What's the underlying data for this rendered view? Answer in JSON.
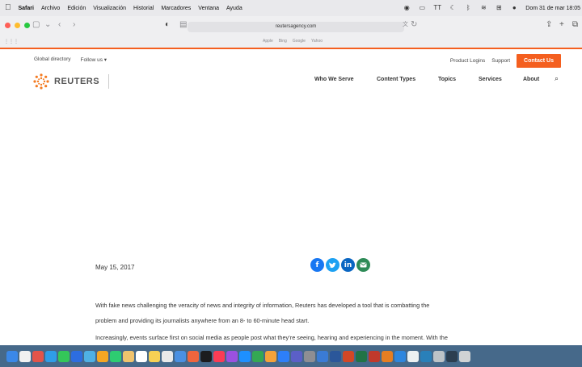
{
  "menubar": {
    "app": "Safari",
    "items": [
      "Archivo",
      "Edición",
      "Visualización",
      "Historial",
      "Marcadores",
      "Ventana",
      "Ayuda"
    ],
    "clock": "Dom 31 de mar  18:05"
  },
  "browser": {
    "url": "reutersagency.com",
    "favorites": [
      "Apple",
      "Bing",
      "Google",
      "Yahoo"
    ]
  },
  "site": {
    "logo_text": "REUTERS",
    "top_links": {
      "global": "Global directory",
      "follow": "Follow us ▾",
      "logins": "Product Logins",
      "support": "Support",
      "contact": "Contact Us"
    },
    "nav": [
      "Who We Serve",
      "Content Types",
      "Topics",
      "Services",
      "About"
    ]
  },
  "article": {
    "date": "May 15, 2017",
    "share": [
      "facebook-icon",
      "twitter-icon",
      "linkedin-icon",
      "email-icon"
    ],
    "para1_line1": "With fake news challenging the veracity of news and integrity of information, Reuters has developed a tool that is combatting the",
    "para1_line2": "problem and providing its journalists anywhere from an 8- to 60-minute head start.",
    "para2_line1": "Increasingly, events surface first on social media as people post what they’re seeing, hearing and experiencing in the moment. With the"
  },
  "colors": {
    "accent": "#f45f1f",
    "facebook": "#1877f2",
    "twitter": "#1da1f2",
    "linkedin": "#0a66c2",
    "email": "#2e8b57"
  }
}
